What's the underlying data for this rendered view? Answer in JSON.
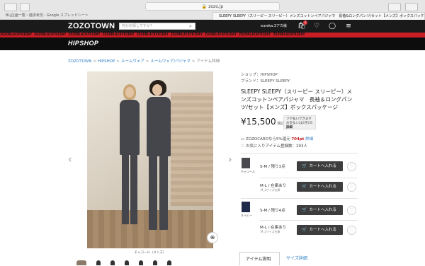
{
  "browser": {
    "url": "zozo.jp",
    "tabs": [
      "BLJ企画一覧・進捗状況 - Google スプレッドシート",
      "SLEEPY SLEEPY（スリーピー スリーピー）メンズコットンペアパジャマ　長袖&ロングパンツ/セット【メンズ】ボックスパッケージ（ルームウェアパ"
    ]
  },
  "header": {
    "logo": "ZOZOTOWN",
    "search_placeholder": "何かお探しですか？",
    "search_icon": "search-icon",
    "user_label": "eureka.3アカ様",
    "cart_badge": "1",
    "promo_text": "ZOZOBLACKFRIDAY ZOZOBLACKFRIDAY ZOZOBLACKFRIDAY ZOZOBLACKFRIDAY ZOZOBLACKFRIDAY ZOZOBLACKFRIDAY ZOZOBLACKFRIDAY ZOZOBLACKFRIDAY ZOZOBLACKFRIDAY",
    "shop_logo": "HIPSHOP"
  },
  "breadcrumb": {
    "items": [
      "ZOZOTOWN",
      "HIPSHOP",
      "ルームウェア",
      "ルームウェア/パジャマ"
    ],
    "current": "アイテム詳細",
    "separator": ">"
  },
  "product": {
    "shop_line": "ショップ：HIPSHOP",
    "brand_line": "ブランド：SLEEPY SLEEPY",
    "title": "SLEEPY SLEEPY（スリーピー スリーピー）メンズコットンペアパジャマ　長袖＆ロングパンツ/セット【メンズ】ボックスパッケージ",
    "price": "¥15,500",
    "tax_label": "税込",
    "pay_later_title": "ツケ払いできます",
    "pay_later_note": "お支払いは2月5日",
    "pay_later_detail": "詳細",
    "points_prefix": "ZOZOCARDなら5%還元",
    "points_value": "704pt",
    "points_link": "詳細",
    "favorites_text": "お気に入りアイテム登録数：293人",
    "image_caption": "チャコール（メンズ）"
  },
  "skus": [
    {
      "color_label": "チャコール",
      "size": "S-M / 残り3点",
      "stock_note": "",
      "cart_label": "カートへ入れる"
    },
    {
      "color_label": "",
      "size": "M-L / 在庫あり",
      "stock_note": "M_Lサイズ在庫",
      "cart_label": "カートへ入れる"
    },
    {
      "color_label": "ネイビー",
      "size": "S-M / 残り4点",
      "stock_note": "",
      "cart_label": "カートへ入れる"
    },
    {
      "color_label": "",
      "size": "M-L / 在庫あり",
      "stock_note": "M_Lサイズ在庫",
      "cart_label": "カートへ入れる"
    }
  ],
  "detail_tabs": [
    "アイテム説明",
    "サイズ詳細"
  ],
  "colors": {
    "header_bg": "#1a1a1a",
    "promo_red": "#c81d25",
    "link_blue": "#2d7ec4",
    "cart_button": "#3d3d3d",
    "points_red": "#c81d25"
  }
}
